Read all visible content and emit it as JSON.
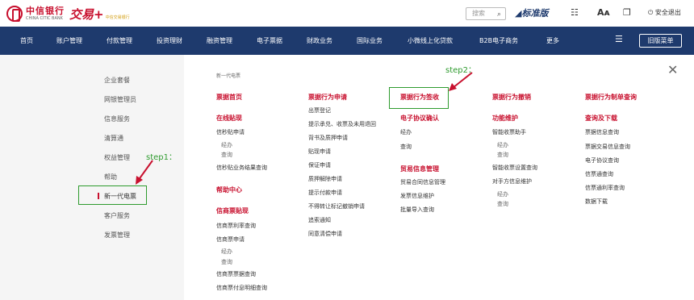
{
  "header": {
    "bank_name": "中信银行",
    "bank_name_en": "CHINA CITIC BANK",
    "product_logo": "交易+",
    "product_sub": "中信交易银行",
    "search_placeholder": "搜索",
    "version": "标准版",
    "logout": "安全退出"
  },
  "nav": {
    "items": [
      "首页",
      "账户管理",
      "付款管理",
      "投资理财",
      "融资管理",
      "电子票据",
      "财政业务",
      "国际业务",
      "小微线上化贷款",
      "B2B电子商务",
      "更多"
    ],
    "old_menu": "旧版菜单"
  },
  "left_menu": {
    "items": [
      "企业套餐",
      "网银管理员",
      "信息服务",
      "清算通",
      "权益管理",
      "帮助",
      "新一代电票",
      "客户服务",
      "发票管理"
    ],
    "active_index": 6
  },
  "panel": {
    "breadcrumb": "新一代电票",
    "col1": {
      "title1": "票据首页",
      "title2": "在线贴现",
      "links1": [
        "信秒贴申请"
      ],
      "subs1": [
        "经办",
        "查询"
      ],
      "links2": [
        "信秒贴业务结果查询"
      ],
      "title3": "帮助中心",
      "title4": "信商票贴现",
      "links3": [
        "信商票利率查询",
        "信商票申请"
      ],
      "subs2": [
        "经办",
        "查询"
      ],
      "links4": [
        "信商票票据查询",
        "信商票付息明细查询"
      ]
    },
    "col2": {
      "title": "票据行为申请",
      "links": [
        "出票登记",
        "提示承兑、收票及未用退回",
        "背书及质押申请",
        "贴现申请",
        "保证申请",
        "质押解除申请",
        "提示付款申请",
        "不得转让标记撤销申请",
        "追索通知",
        "同意清偿申请"
      ]
    },
    "col3": {
      "title1": "票据行为签收",
      "title2": "电子协议确认",
      "links1": [
        "经办",
        "查询"
      ],
      "title3": "贸易信息管理",
      "links2": [
        "贸易合同信息管理",
        "发票信息维护",
        "批量导入查询"
      ]
    },
    "col4": {
      "title1": "票据行为撤销",
      "title2": "功能维护",
      "links1": [
        "智能收票助手"
      ],
      "subs1": [
        "经办",
        "查询"
      ],
      "links2": [
        "智能收票设置查询",
        "对手方信息维护"
      ],
      "subs2": [
        "经办",
        "查询"
      ]
    },
    "col5": {
      "title1": "票据行为制单查询",
      "title2": "查询及下载",
      "links": [
        "票据信息查询",
        "票据交易信息查询",
        "电子协议查询",
        "信票通查询",
        "信票通利率查询",
        "数据下载"
      ]
    }
  },
  "annotations": {
    "step1": "step1：",
    "step2": "step2："
  },
  "colors": {
    "navy": "#1e3a6d",
    "red": "#c8102e",
    "green": "#2e9b2e"
  }
}
